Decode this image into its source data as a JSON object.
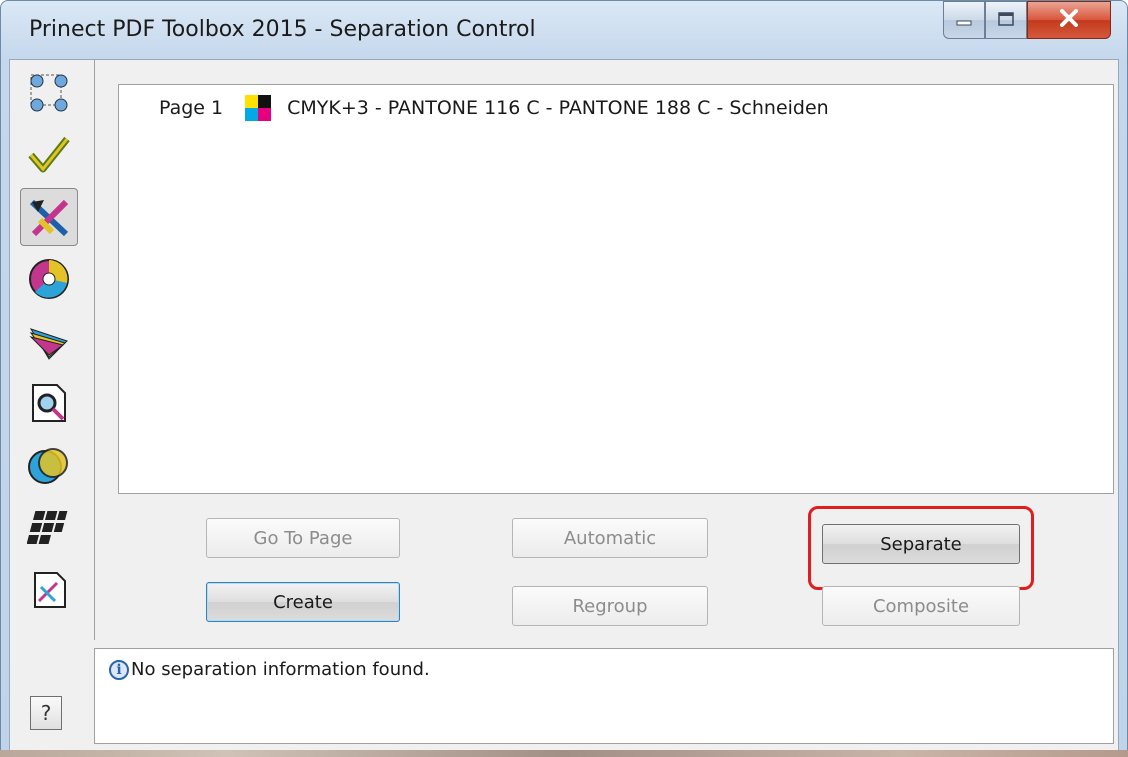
{
  "window": {
    "title": "Prinect PDF Toolbox 2015 - Separation Control",
    "controls": {
      "minimize": "minimize-icon",
      "maximize": "maximize-icon",
      "close": "close-icon"
    }
  },
  "sidebar": {
    "items": [
      {
        "icon": "connection-nodes-icon"
      },
      {
        "icon": "checkmark-icon"
      },
      {
        "icon": "separation-tool-icon",
        "selected": true
      },
      {
        "icon": "color-disc-icon"
      },
      {
        "icon": "color-swatch-fan-icon"
      },
      {
        "icon": "document-magnifier-icon"
      },
      {
        "icon": "overlapping-circles-icon"
      },
      {
        "icon": "grid-tiles-icon"
      },
      {
        "icon": "document-pen-icon"
      }
    ],
    "help_label": "?"
  },
  "list": {
    "rows": [
      {
        "page": "Page 1",
        "swatch_icon": "cmyk-swatch-icon",
        "colors": "CMYK+3 - PANTONE 116 C - PANTONE 188 C - Schneiden"
      }
    ]
  },
  "buttons": {
    "go_to_page": "Go To Page",
    "automatic": "Automatic",
    "separate": "Separate",
    "create": "Create",
    "regroup": "Regroup",
    "composite": "Composite"
  },
  "status": {
    "icon": "info-icon",
    "info_glyph": "i",
    "message": "No separation information found."
  },
  "colors": {
    "highlight": "#e11d1d",
    "close_button": "#c9452a",
    "title_bar": "#c4d7ec"
  }
}
